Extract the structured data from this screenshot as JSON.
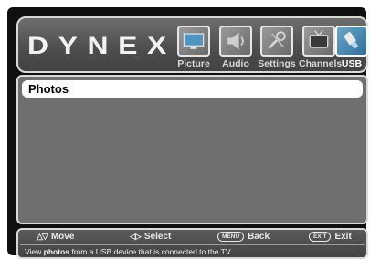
{
  "brand": "DYNEX",
  "tabs": [
    {
      "label": "Picture",
      "icon": "picture-icon"
    },
    {
      "label": "Audio",
      "icon": "audio-speaker-icon"
    },
    {
      "label": "Settings",
      "icon": "settings-icon"
    },
    {
      "label": "Channels",
      "icon": "channels-icon"
    },
    {
      "label": "USB",
      "icon": "usb-icon",
      "active": true
    }
  ],
  "menu": {
    "items": [
      {
        "label": "Photos",
        "selected": true
      }
    ]
  },
  "footer": {
    "move": "Move",
    "select": "Select",
    "menu_key": "MENU",
    "back": "Back",
    "exit_key": "EXIT",
    "exit": "Exit",
    "help_prefix": "View ",
    "help_bold": "photos",
    "help_suffix": " from a USB device that is connected to the TV"
  },
  "colors": {
    "accent": "#2d6f9c",
    "panel": "#6f6f6f",
    "highlight": "#ffffff"
  }
}
